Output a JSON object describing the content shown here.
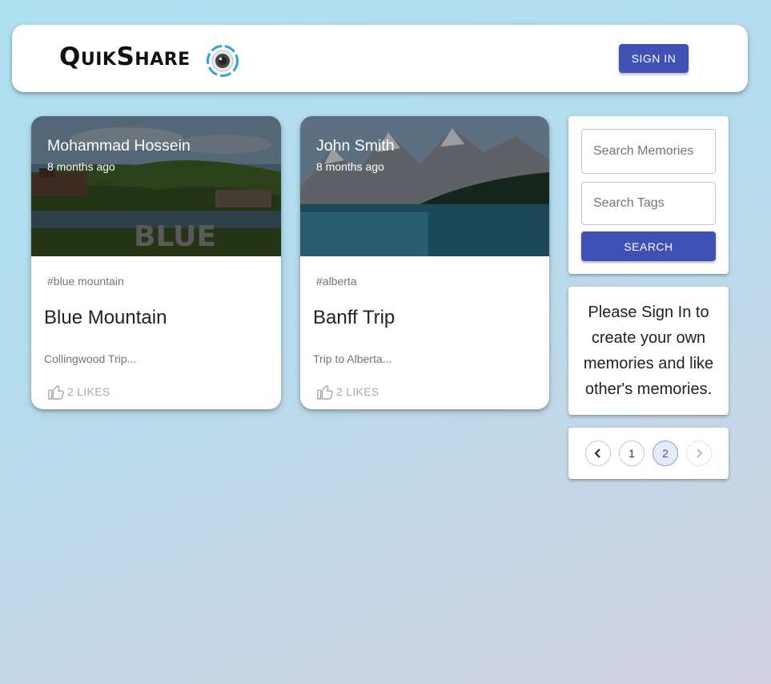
{
  "header": {
    "brand": "QuikShare",
    "sign_in_label": "SIGN IN"
  },
  "posts": [
    {
      "author": "Mohammad Hossein",
      "time": "8 months ago",
      "tags": "#blue mountain",
      "title": "Blue Mountain",
      "message": "Collingwood Trip...",
      "likes": "2 LIKES"
    },
    {
      "author": "John Smith",
      "time": "8 months ago",
      "tags": "#alberta",
      "title": "Banff Trip",
      "message": "Trip to Alberta...",
      "likes": "2 LIKES"
    }
  ],
  "search": {
    "memories_placeholder": "Search Memories",
    "tags_placeholder": "Search Tags",
    "button_label": "SEARCH"
  },
  "info": {
    "text": "Please Sign In to create your own memories and like other's memories."
  },
  "pagination": {
    "pages": [
      "1",
      "2"
    ],
    "current": "2"
  },
  "colors": {
    "primary": "#3f51b5"
  }
}
